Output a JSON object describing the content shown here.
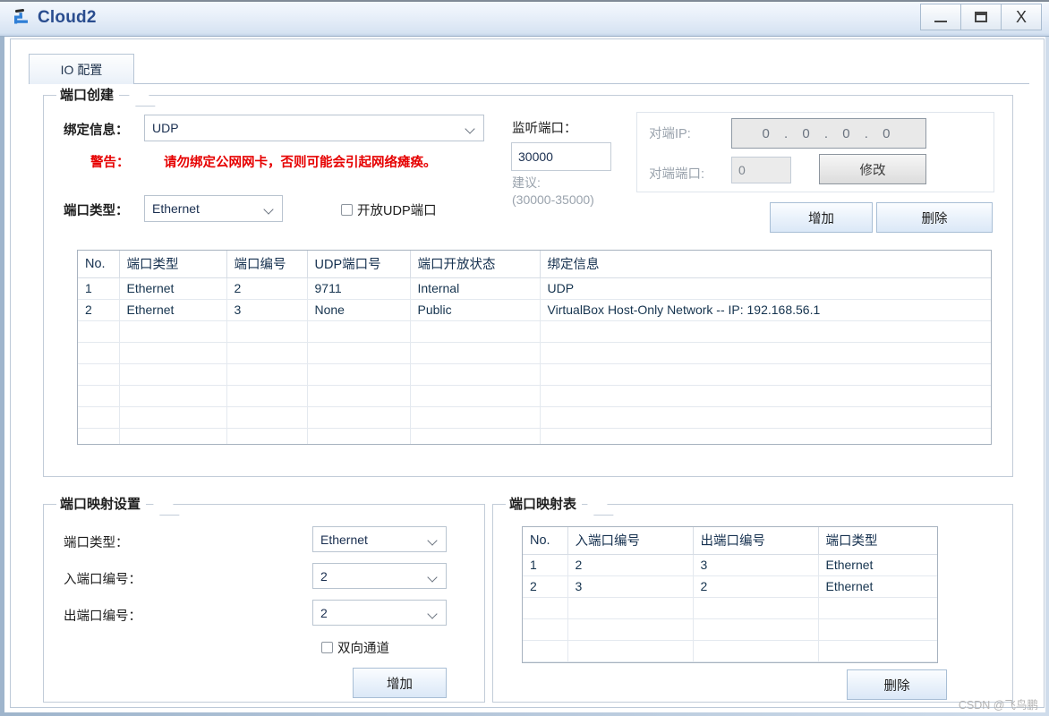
{
  "window": {
    "title": "Cloud2",
    "icon": "cloud-network-icon",
    "controls": {
      "minimize_label": "_",
      "maximize_label": "❐",
      "close_label": "X"
    }
  },
  "tabs": [
    {
      "label": "IO 配置",
      "active": true
    }
  ],
  "port_create": {
    "title": "端口创建",
    "bind_info_label": "绑定信息：",
    "bind_info_value": "UDP",
    "warning_label": "警告：",
    "warning_text": "请勿绑定公网网卡，否则可能会引起网络瘫痪。",
    "port_type_label": "端口类型：",
    "port_type_value": "Ethernet",
    "open_udp_checkbox_label": "开放UDP端口",
    "open_udp_checked": false,
    "listen_port_label": "监听端口：",
    "listen_port_value": "30000",
    "listen_hint_line1": "建议:",
    "listen_hint_line2": "(30000-35000)",
    "peer_ip_label": "对端IP:",
    "peer_ip_value": "0 . 0 . 0 . 0",
    "peer_port_label": "对端端口:",
    "peer_port_value": "0",
    "modify_button": "修改",
    "add_button": "增加",
    "delete_button": "删除",
    "table": {
      "headers": [
        "No.",
        "端口类型",
        "端口编号",
        "UDP端口号",
        "端口开放状态",
        "绑定信息"
      ],
      "rows": [
        [
          "1",
          "Ethernet",
          "2",
          "9711",
          "Internal",
          "UDP"
        ],
        [
          "2",
          "Ethernet",
          "3",
          "None",
          "Public",
          "VirtualBox Host-Only Network -- IP: 192.168.56.1"
        ]
      ],
      "empty_row_count": 7
    }
  },
  "mapping_settings": {
    "title": "端口映射设置",
    "port_type_label": "端口类型：",
    "port_type_value": "Ethernet",
    "in_port_label": "入端口编号：",
    "in_port_value": "2",
    "out_port_label": "出端口编号：",
    "out_port_value": "2",
    "bidirectional_label": "双向通道",
    "bidirectional_checked": false,
    "add_button": "增加"
  },
  "mapping_table": {
    "title": "端口映射表",
    "headers": [
      "No.",
      "入端口编号",
      "出端口编号",
      "端口类型"
    ],
    "rows": [
      [
        "1",
        "2",
        "3",
        "Ethernet"
      ],
      [
        "2",
        "3",
        "2",
        "Ethernet"
      ]
    ],
    "empty_row_count": 4,
    "delete_button": "删除"
  },
  "watermark": "CSDN @飞鸟鹏",
  "colors": {
    "title_accent": "#2a4d8f",
    "warning": "#e60000",
    "table_text": "#16344f",
    "hint": "#9aa3ad"
  }
}
